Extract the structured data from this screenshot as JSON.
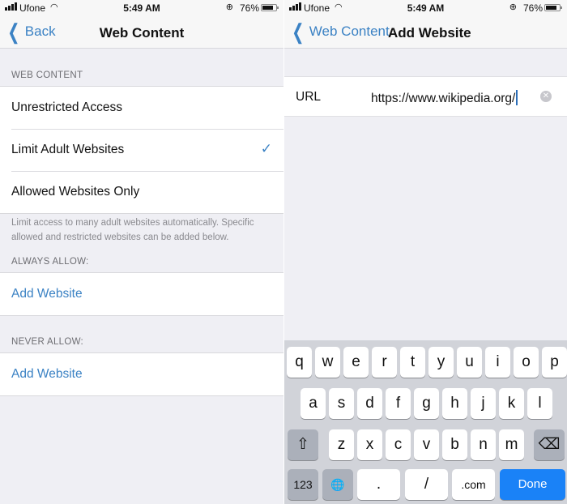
{
  "status_bar": {
    "carrier": "Ufone",
    "time": "5:49 AM",
    "battery_percent": "76%",
    "battery_level": 0.76,
    "icons": [
      "signal-icon",
      "wifi-icon",
      "orientation-lock-icon",
      "battery-icon"
    ]
  },
  "left_screen": {
    "nav": {
      "back_label": "Back",
      "title": "Web Content"
    },
    "web_content_header": "WEB CONTENT",
    "options": [
      {
        "label": "Unrestricted Access",
        "selected": false
      },
      {
        "label": "Limit Adult Websites",
        "selected": true
      },
      {
        "label": "Allowed Websites Only",
        "selected": false
      }
    ],
    "check_glyph": "✓",
    "footer_note": "Limit access to many adult websites automatically. Specific allowed and restricted websites can be added below.",
    "always_allow_header": "ALWAYS ALLOW:",
    "always_allow_add": "Add Website",
    "never_allow_header": "NEVER ALLOW:",
    "never_allow_add": "Add Website"
  },
  "right_screen": {
    "nav": {
      "back_label": "Web Content",
      "title": "Add Website"
    },
    "url_field": {
      "label": "URL",
      "value": "https://www.wikipedia.org/",
      "clear_glyph": "✕"
    },
    "keyboard": {
      "row1": [
        "q",
        "w",
        "e",
        "r",
        "t",
        "y",
        "u",
        "i",
        "o",
        "p"
      ],
      "row2": [
        "a",
        "s",
        "d",
        "f",
        "g",
        "h",
        "j",
        "k",
        "l"
      ],
      "row3": [
        "z",
        "x",
        "c",
        "v",
        "b",
        "n",
        "m"
      ],
      "shift_glyph": "⇧",
      "delete_glyph": "⌫",
      "numbers_label": "123",
      "globe_glyph": "🌐",
      "dot_label": ".",
      "slash_label": "/",
      "dotcom_label": ".com",
      "done_label": "Done"
    }
  },
  "colors": {
    "accent": "#3b82c4",
    "done_key": "#1a82f7",
    "background": "#efeff4"
  }
}
